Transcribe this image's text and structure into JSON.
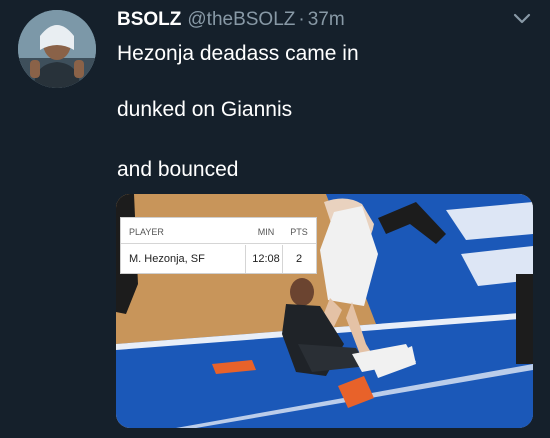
{
  "tweet": {
    "display_name": "BSOLZ",
    "handle": "@theBSOLZ",
    "separator": "·",
    "time": "37m",
    "lines": [
      "Hezonja deadass came in",
      "dunked on Giannis",
      "and bounced"
    ]
  },
  "stat_box": {
    "headers": {
      "player": "PLAYER",
      "min": "MIN",
      "pts": "PTS"
    },
    "row": {
      "player": "M. Hezonja, SF",
      "min": "12:08",
      "pts": "2"
    }
  },
  "colors": {
    "background": "#15202b",
    "secondary_text": "#8899a6",
    "court_wood": "#c8955a",
    "court_blue": "#1b58b8",
    "court_orange": "#e8622a"
  },
  "icons": {
    "menu": "chevron-down-icon"
  }
}
